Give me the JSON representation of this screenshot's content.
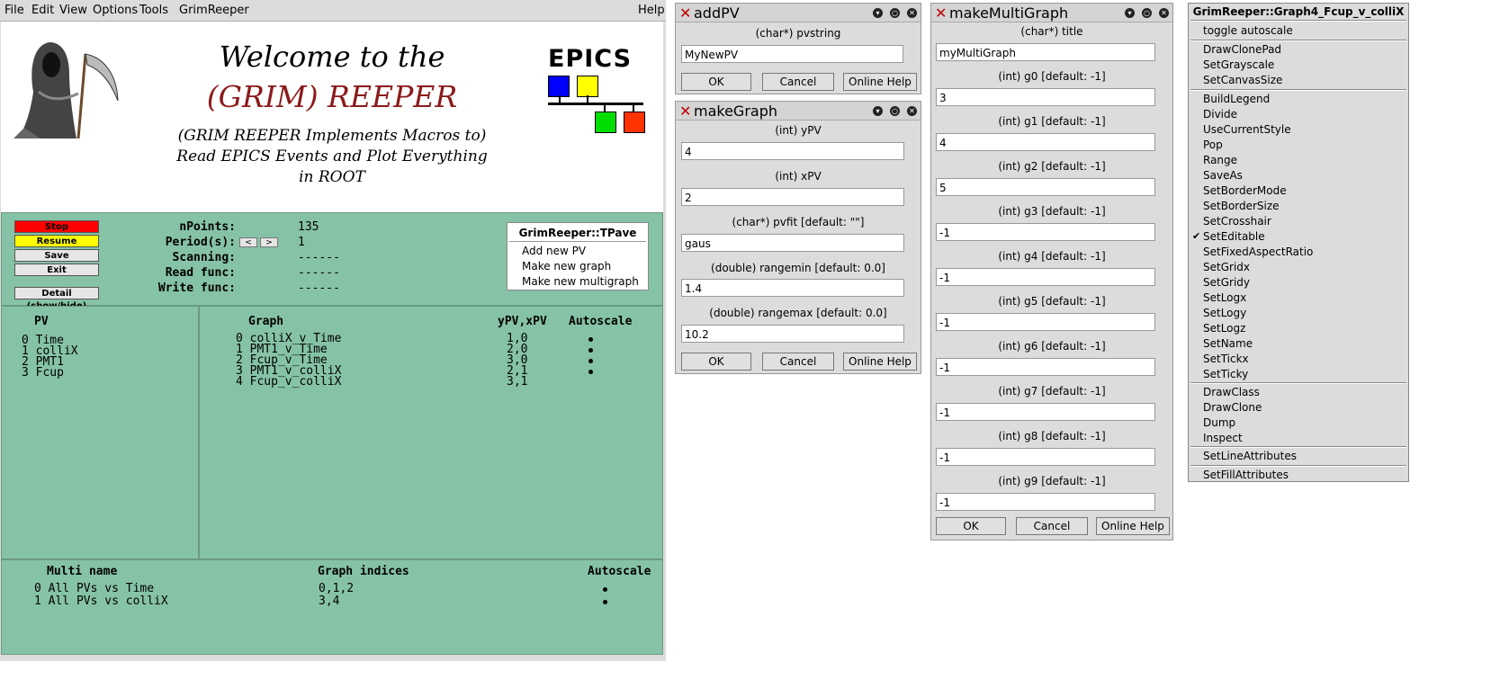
{
  "menubar": {
    "file": "File",
    "edit": "Edit",
    "view": "View",
    "options": "Options",
    "tools": "Tools",
    "app": "GrimReeper",
    "help": "Help"
  },
  "banner": {
    "line1": "Welcome to the",
    "line2": "(GRIM) REEPER",
    "line3": "(GRIM REEPER Implements Macros to)",
    "line4": "Read EPICS Events and Plot Everything",
    "line5": "in ROOT",
    "epics_logo": "EPICS"
  },
  "controls": {
    "stop": "Stop",
    "resume": "Resume",
    "save": "Save",
    "exit": "Exit",
    "detail": "Detail (show/hide)",
    "stop_color": "#ff0000",
    "resume_color": "#ffff00",
    "npoints_label": "nPoints:",
    "npoints_value": "135",
    "period_label": "Period(s):",
    "period_value": "1",
    "period_dec": "<",
    "period_inc": ">",
    "scanning_label": "Scanning:",
    "scanning_value": "------",
    "readfunc_label": "Read func:",
    "readfunc_value": "------",
    "writefunc_label": "Write func:",
    "writefunc_value": "------"
  },
  "tpave": {
    "title": "GrimReeper::TPave",
    "items": [
      "Add new PV",
      "Make new graph",
      "Make new multigraph"
    ]
  },
  "pv_panel": {
    "header": "PV",
    "rows": [
      "0 Time",
      "1 colliX",
      "2 PMT1",
      "3 Fcup"
    ]
  },
  "graph_panel": {
    "header_graph": "Graph",
    "header_xy": "yPV,xPV",
    "header_auto": "Autoscale",
    "rows": [
      {
        "name": "0 colliX_v_Time",
        "xy": "1,0"
      },
      {
        "name": "1 PMT1_v_Time",
        "xy": "2,0"
      },
      {
        "name": "2 Fcup_v_Time",
        "xy": "3,0"
      },
      {
        "name": "3 PMT1_v_colliX",
        "xy": "2,1"
      },
      {
        "name": "4 Fcup_v_colliX",
        "xy": "3,1"
      }
    ]
  },
  "multi_panel": {
    "header_name": "Multi name",
    "header_idx": "Graph indices",
    "header_auto": "Autoscale",
    "rows": [
      {
        "name": "0 All PVs vs Time",
        "idx": "0,1,2"
      },
      {
        "name": "1 All PVs vs colliX",
        "idx": "3,4"
      }
    ]
  },
  "addpv": {
    "title": "addPV",
    "label": "(char*)  pvstring",
    "value": "MyNewPV",
    "ok": "OK",
    "cancel": "Cancel",
    "help": "Online Help"
  },
  "makegraph": {
    "title": "makeGraph",
    "fields": [
      {
        "label": "(int)  yPV",
        "value": "4"
      },
      {
        "label": "(int)  xPV",
        "value": "2"
      },
      {
        "label": "(char*)  pvfit  [default: \"\"]",
        "value": "gaus"
      },
      {
        "label": "(double)  rangemin  [default: 0.0]",
        "value": "1.4"
      },
      {
        "label": "(double)  rangemax  [default: 0.0]",
        "value": "10.2"
      }
    ],
    "ok": "OK",
    "cancel": "Cancel",
    "help": "Online Help"
  },
  "makemulti": {
    "title": "makeMultiGraph",
    "fields": [
      {
        "label": "(char*)  title",
        "value": "myMultiGraph"
      },
      {
        "label": "(int)  g0  [default: -1]",
        "value": "3"
      },
      {
        "label": "(int)  g1  [default: -1]",
        "value": "4"
      },
      {
        "label": "(int)  g2  [default: -1]",
        "value": "5"
      },
      {
        "label": "(int)  g3  [default: -1]",
        "value": "-1"
      },
      {
        "label": "(int)  g4  [default: -1]",
        "value": "-1"
      },
      {
        "label": "(int)  g5  [default: -1]",
        "value": "-1"
      },
      {
        "label": "(int)  g6  [default: -1]",
        "value": "-1"
      },
      {
        "label": "(int)  g7  [default: -1]",
        "value": "-1"
      },
      {
        "label": "(int)  g8  [default: -1]",
        "value": "-1"
      },
      {
        "label": "(int)  g9  [default: -1]",
        "value": "-1"
      }
    ],
    "ok": "OK",
    "cancel": "Cancel",
    "help": "Online Help"
  },
  "context_menu": {
    "title": "GrimReeper::Graph4_Fcup_v_colliX",
    "group1": [
      "toggle autoscale"
    ],
    "group2": [
      "DrawClonePad",
      "SetGrayscale",
      "SetCanvasSize"
    ],
    "group3": [
      "BuildLegend",
      "Divide",
      "UseCurrentStyle",
      "Pop",
      "Range",
      "SaveAs",
      "SetBorderMode",
      "SetBorderSize",
      "SetCrosshair",
      "SetEditable",
      "SetFixedAspectRatio",
      "SetGridx",
      "SetGridy",
      "SetLogx",
      "SetLogy",
      "SetLogz",
      "SetName",
      "SetTickx",
      "SetTicky"
    ],
    "group4": [
      "DrawClass",
      "DrawClone",
      "Dump",
      "Inspect"
    ],
    "group5": [
      "SetLineAttributes"
    ],
    "group6": [
      "SetFillAttributes"
    ],
    "checked": "SetEditable"
  }
}
